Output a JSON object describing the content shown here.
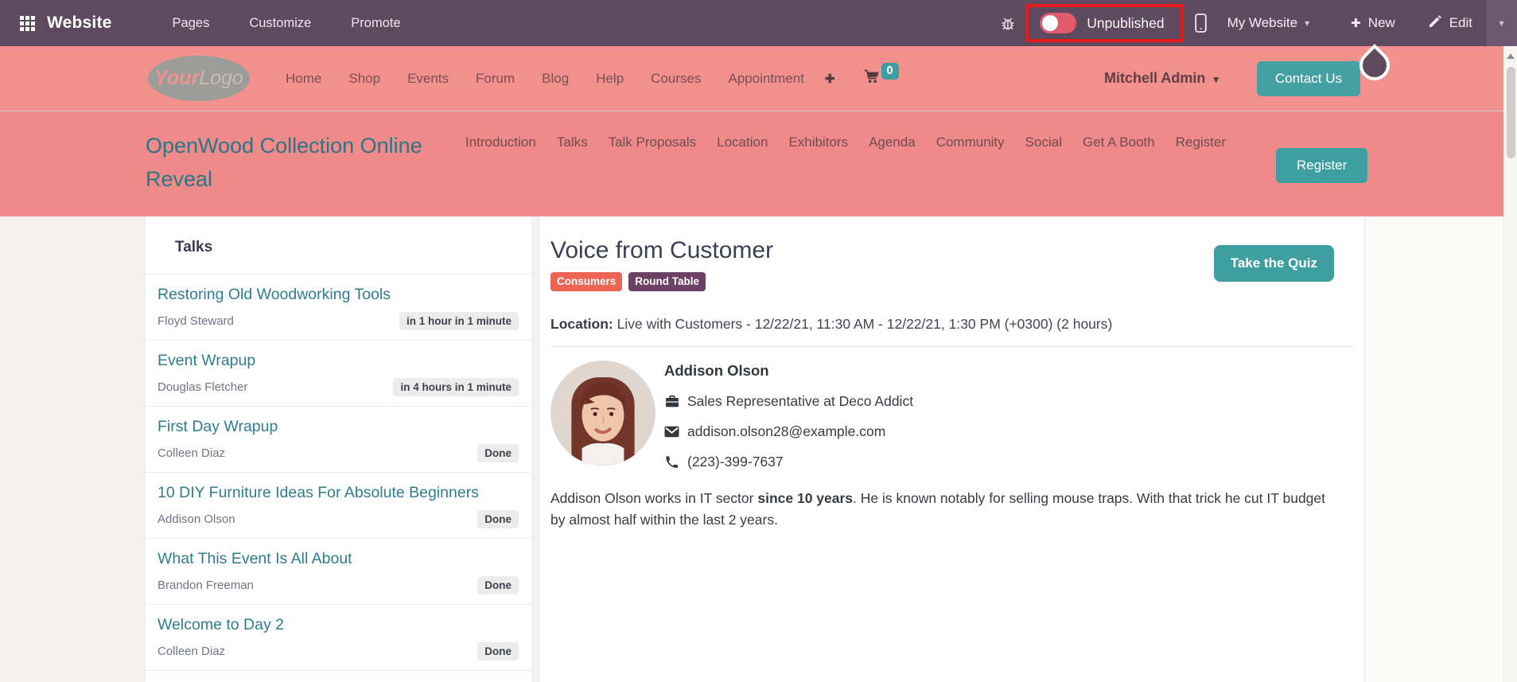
{
  "backend_toolbar": {
    "brand": "Website",
    "menu_pages": "Pages",
    "menu_customize": "Customize",
    "menu_promote": "Promote",
    "publish_label": "Unpublished",
    "publish_state": "off",
    "website_switcher": "My Website",
    "new_label": "New",
    "edit_label": "Edit"
  },
  "site_nav": {
    "logo_part1": "Your",
    "logo_part2": "Logo",
    "items": [
      "Home",
      "Shop",
      "Events",
      "Forum",
      "Blog",
      "Help",
      "Courses",
      "Appointment"
    ],
    "plus_label": "✚",
    "cart_count": "0",
    "user_menu": "Mitchell Admin",
    "contact_button": "Contact Us"
  },
  "event_header": {
    "title": "OpenWood Collection Online Reveal",
    "menu": [
      "Introduction",
      "Talks",
      "Talk Proposals",
      "Location",
      "Exhibitors",
      "Agenda",
      "Community",
      "Social",
      "Get A Booth",
      "Register"
    ],
    "register_button": "Register"
  },
  "talks_sidebar": {
    "heading": "Talks",
    "items": [
      {
        "title": "Restoring Old Woodworking Tools",
        "speaker": "Floyd Steward",
        "status": "in 1 hour in 1 minute"
      },
      {
        "title": "Event Wrapup",
        "speaker": "Douglas Fletcher",
        "status": "in 4 hours in 1 minute"
      },
      {
        "title": "First Day Wrapup",
        "speaker": "Colleen Diaz",
        "status": "Done"
      },
      {
        "title": "10 DIY Furniture Ideas For Absolute Beginners",
        "speaker": "Addison Olson",
        "status": "Done"
      },
      {
        "title": "What This Event Is All About",
        "speaker": "Brandon Freeman",
        "status": "Done"
      },
      {
        "title": "Welcome to Day 2",
        "speaker": "Colleen Diaz",
        "status": "Done"
      }
    ]
  },
  "talk_detail": {
    "title": "Voice from Customer",
    "tags": [
      {
        "label": "Consumers",
        "color": "#ed6453"
      },
      {
        "label": "Round Table",
        "color": "#6d4164"
      }
    ],
    "quiz_button": "Take the Quiz",
    "location_label": "Location:",
    "location_value": " Live with Customers - 12/22/21, 11:30 AM - 12/22/21, 1:30 PM (+0300) (2 hours)",
    "speaker": {
      "name": "Addison Olson",
      "job": "Sales Representative at Deco Addict",
      "email": "addison.olson28@example.com",
      "phone": "(223)-399-7637",
      "bio_part1": "Addison Olson works in IT sector ",
      "bio_bold": "since 10 years",
      "bio_part2": ". He is known notably for selling mouse traps. With that trick he cut IT budget by almost half within the last 2 years."
    }
  },
  "colors": {
    "toolbar_bg": "#5e4a5e",
    "nav_bg": "#f2908d",
    "event_header_bg": "#ee8a89",
    "accent_teal": "#3f9ea0",
    "toggle_red": "#e25a6e",
    "highlight_red": "#e8191d",
    "link_teal": "#2f7d8c"
  }
}
